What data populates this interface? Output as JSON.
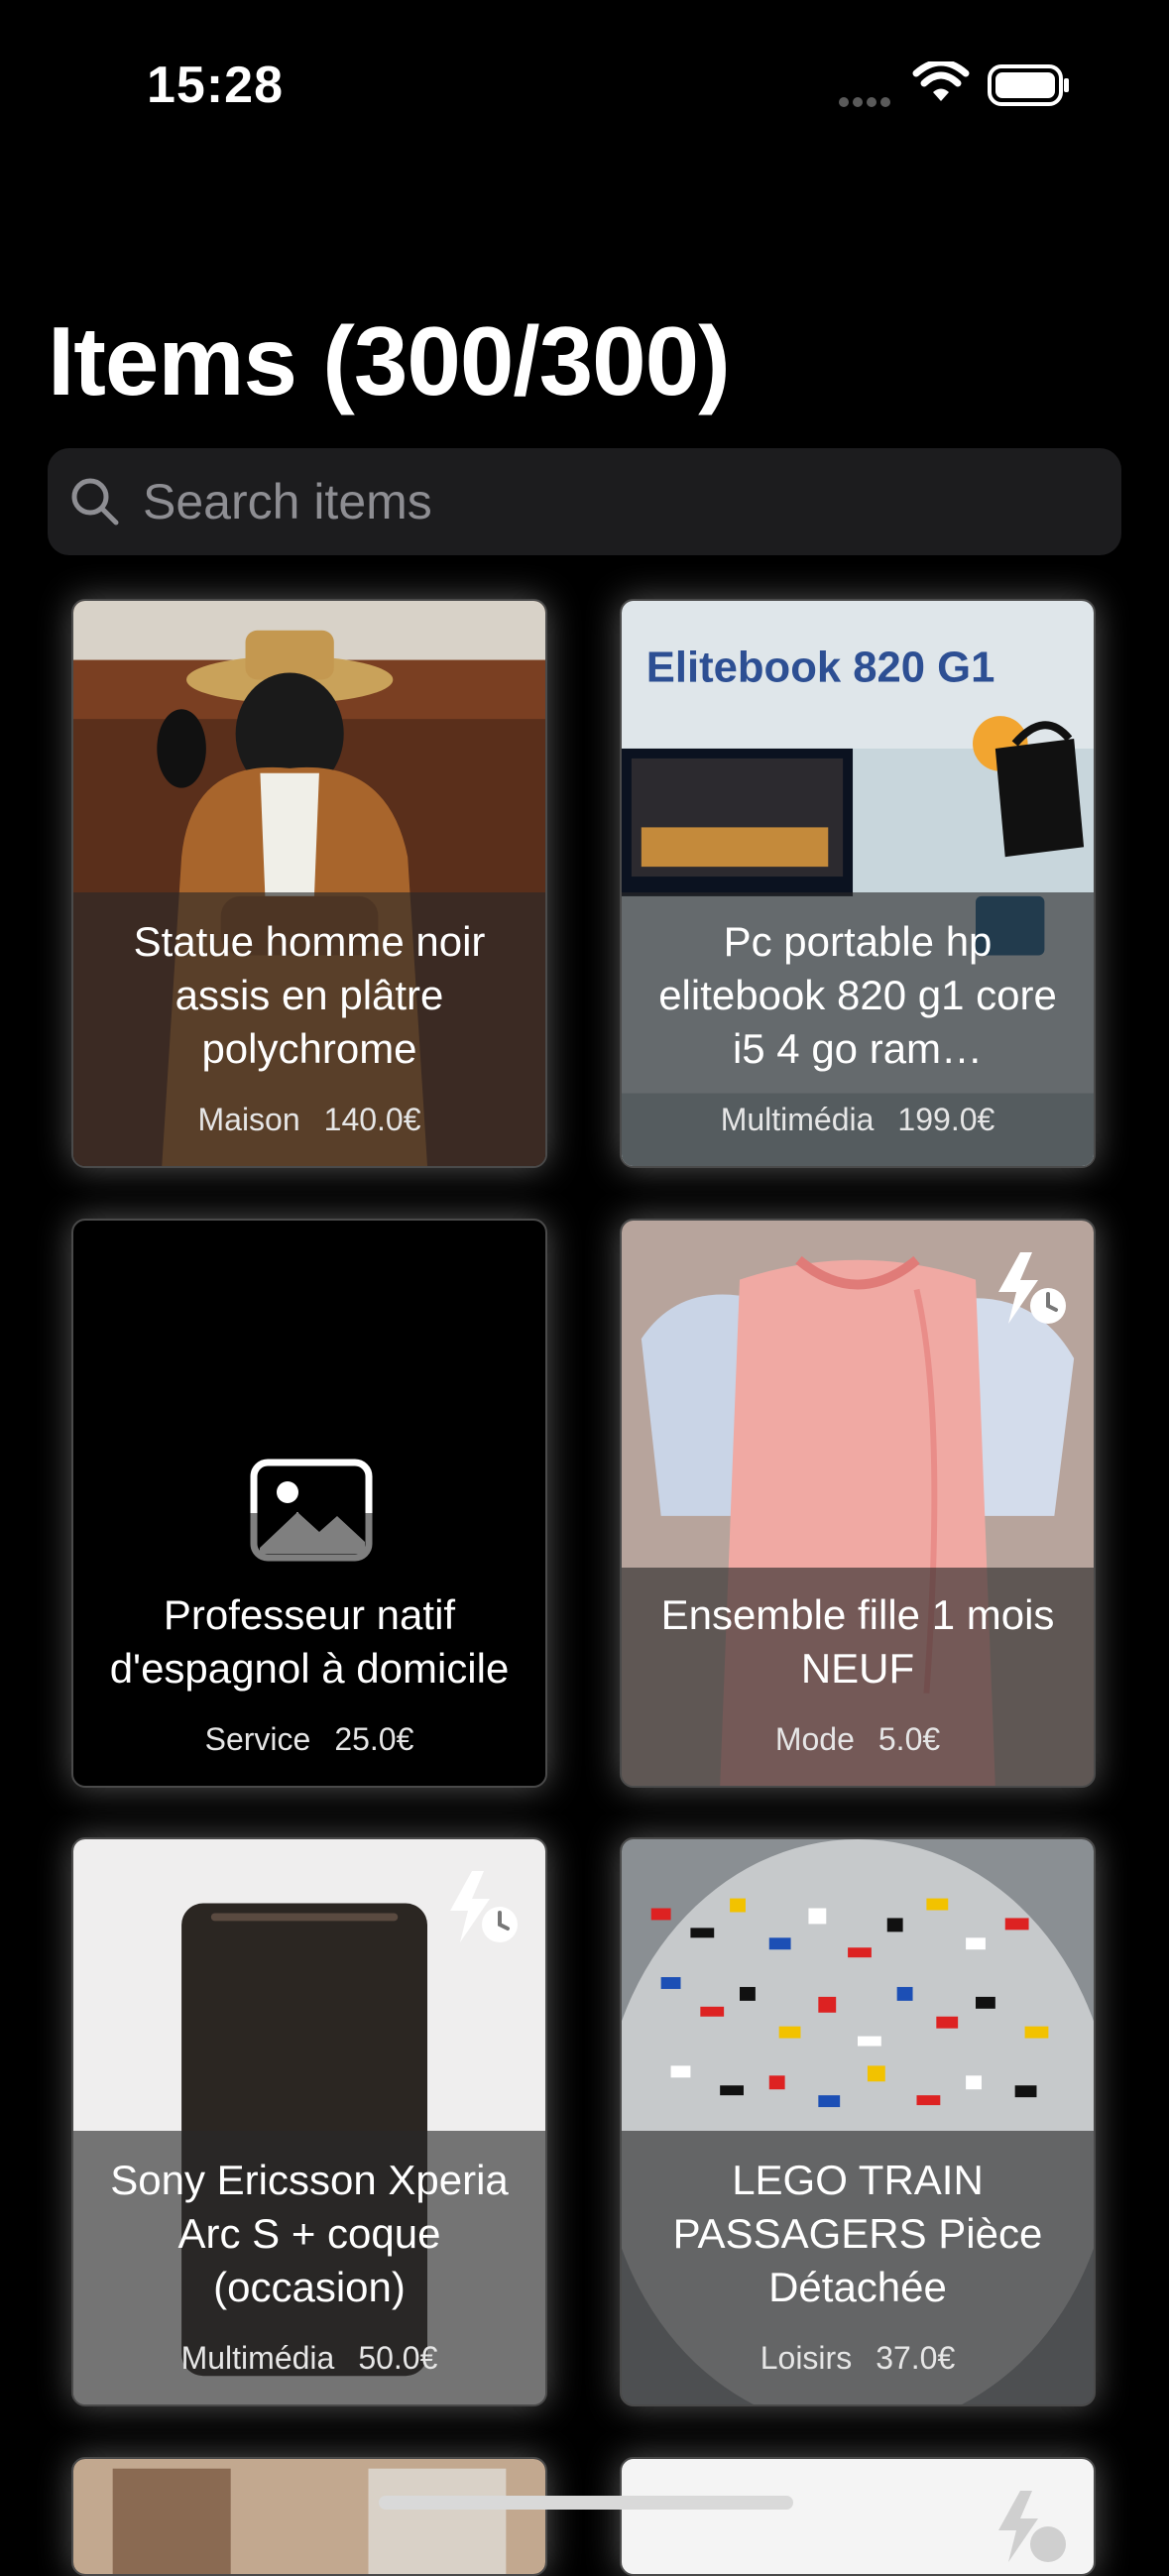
{
  "status": {
    "time": "15:28"
  },
  "header": {
    "title": "Items (300/300)"
  },
  "search": {
    "placeholder": "Search items"
  },
  "items": [
    {
      "title": "Statue homme noir assis en plâtre polychrome",
      "category": "Maison",
      "price": "140.0€",
      "image": "statue-photo",
      "boosted": false
    },
    {
      "title": "Pc portable hp elitebook 820 g1 core i5 4 go ram…",
      "category": "Multimédia",
      "price": "199.0€",
      "image": "laptop-photo",
      "image_text": "Elitebook 820 G1",
      "boosted": false
    },
    {
      "title": "Professeur natif d'espagnol à domicile",
      "category": "Service",
      "price": "25.0€",
      "image": "image-placeholder-icon",
      "boosted": false
    },
    {
      "title": "Ensemble fille 1 mois NEUF",
      "category": "Mode",
      "price": "5.0€",
      "image": "baby-clothes-photo",
      "boosted": true
    },
    {
      "title": "Sony Ericsson Xperia Arc S + coque (occasion)",
      "category": "Multimédia",
      "price": "50.0€",
      "image": "phone-photo",
      "boosted": true
    },
    {
      "title": "LEGO TRAIN PASSAGERS Pièce Détachée",
      "category": "Loisirs",
      "price": "37.0€",
      "image": "lego-photo",
      "boosted": false
    }
  ],
  "icons": {
    "boost": "bolt-clock-icon",
    "search": "magnifier-icon",
    "placeholder": "photo-icon"
  }
}
